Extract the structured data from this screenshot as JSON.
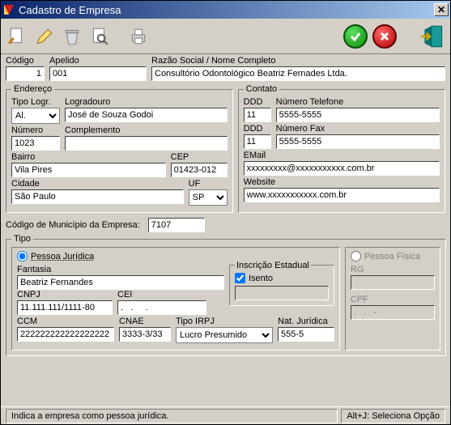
{
  "window": {
    "title": "Cadastro de Empresa"
  },
  "labels": {
    "codigo": "Código",
    "apelido": "Apelido",
    "razao": "Razão Social / Nome Completo",
    "endereco": "Endereço",
    "tipologr": "Tipo Logr.",
    "logradouro": "Logradouro",
    "numero": "Número",
    "complemento": "Complemento",
    "bairro": "Bairro",
    "cep": "CEP",
    "cidade": "Cidade",
    "uf": "UF",
    "contato": "Contato",
    "ddd": "DDD",
    "numtel": "Número Telefone",
    "numfax": "Número Fax",
    "email": "EMail",
    "website": "Website",
    "codmun": "Código de Município da Empresa:",
    "tipo": "Tipo",
    "pj": "Pessoa Jurídica",
    "pf": "Pessoa Física",
    "fantasia": "Fantasia",
    "cnpj": "CNPJ",
    "cei": "CEI",
    "ccm": "CCM",
    "cnae": "CNAE",
    "tipoirpj": "Tipo IRPJ",
    "natjur": "Nat. Jurídica",
    "insc_est": "Inscrição Estadual",
    "isento": "Isento",
    "rg": "RG",
    "cpf": "CPF"
  },
  "values": {
    "codigo": "1",
    "apelido": "001",
    "razao": "Consultório Odontológico Beatriz Fernades Ltda.",
    "tipologr": "Al.",
    "logradouro": "José de Souza Godoi",
    "numero": "1023",
    "complemento": "",
    "bairro": "Vila Pires",
    "cep": "01423-012",
    "cidade": "São Paulo",
    "uf": "SP",
    "ddd_tel": "11",
    "tel": "5555-5555",
    "ddd_fax": "11",
    "fax": "5555-5555",
    "email": "xxxxxxxxx@xxxxxxxxxxx.com.br",
    "website": "www.xxxxxxxxxxx.com.br",
    "codmun": "7107",
    "fantasia": "Beatriz Fernandes",
    "cnpj": "11.111.111/1111-80",
    "cei": ".   .     .",
    "ccm": "222222222222222222",
    "cnae": "3333-3/33",
    "tipoirpj": "Lucro Presumido",
    "natjur": "555-5",
    "insc_est_val": "",
    "isento_checked": true,
    "rg": "",
    "cpf": ".   .   -"
  },
  "options": {
    "tipologr": [
      "Al."
    ],
    "uf": [
      "SP"
    ],
    "tipoirpj": [
      "Lucro Presumido"
    ]
  },
  "status": {
    "left": "Indica a empresa como pessoa jurídica.",
    "right": "Alt+J: Seleciona Opção"
  }
}
